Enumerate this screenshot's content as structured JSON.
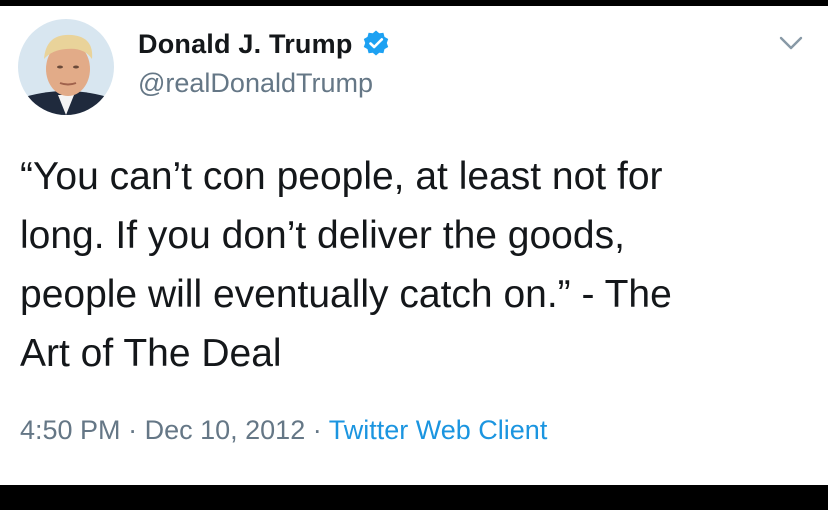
{
  "tweet": {
    "author": {
      "display_name": "Donald J. Trump",
      "handle": "@realDonaldTrump",
      "verified": true,
      "avatar_icon": "profile-photo"
    },
    "text": "“You can’t con people, at least not for\nlong.  If you don’t deliver the goods,\npeople will eventually catch on.” - The\nArt of The Deal",
    "time": "4:50 PM",
    "separator": "·",
    "date": "Dec 10, 2012",
    "source": "Twitter Web Client",
    "menu_icon": "chevron-down-icon"
  },
  "colors": {
    "text": "#14171a",
    "secondary": "#657786",
    "link": "#1b95e0",
    "verified": "#1da1f2",
    "background": "#ffffff",
    "frame": "#000000"
  }
}
